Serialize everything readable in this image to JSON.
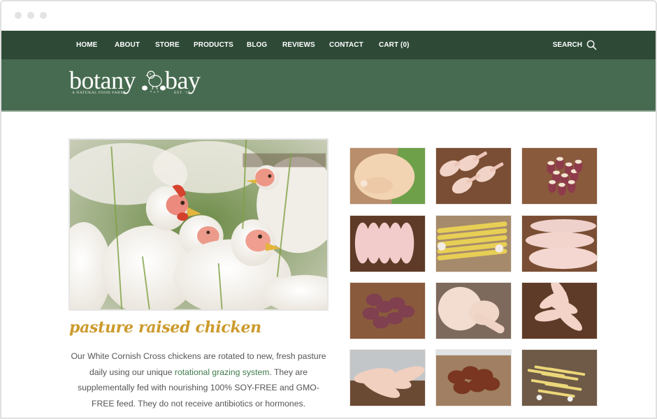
{
  "browser": {
    "window_controls": [
      "close",
      "minimize",
      "maximize"
    ]
  },
  "nav": {
    "items": [
      {
        "label": "HOME"
      },
      {
        "label": "ABOUT"
      },
      {
        "label": "STORE"
      },
      {
        "label": "PRODUCTS"
      },
      {
        "label": "BLOG"
      },
      {
        "label": "REVIEWS"
      },
      {
        "label": "CONTACT"
      },
      {
        "label": "CART (0)"
      }
    ],
    "search_label": "SEARCH",
    "search_icon": "search-icon"
  },
  "brand": {
    "word_left": "botany",
    "word_right": "bay",
    "tagline": "A NATURAL FOOD FARM",
    "established": "EST. '11",
    "mascot_icon": "chick-icon"
  },
  "colors": {
    "nav_bg": "#2e4a37",
    "brand_bg": "#476b50",
    "title_gold": "#cc9a2c",
    "link_green": "#3f7a4a",
    "body_text": "#555555"
  },
  "main": {
    "hero_alt": "White Cornish Cross chickens on pasture",
    "title": "pasture raised chicken",
    "description": {
      "before_link": "Our White Cornish Cross chickens are rotated to new, fresh pasture daily using our unique ",
      "link_text": "rotational grazing system",
      "after_link": ". They are supplementally fed with nourishing 100% SOY-FREE and GMO-FREE feed. They do not receive antibiotics or hormones."
    }
  },
  "products": [
    {
      "name": "whole chicken",
      "kind": "whole"
    },
    {
      "name": "chicken leg quarters",
      "kind": "legs"
    },
    {
      "name": "chicken hearts",
      "kind": "hearts"
    },
    {
      "name": "boneless breasts",
      "kind": "breasts"
    },
    {
      "name": "chicken feet",
      "kind": "feet"
    },
    {
      "name": "breast fillets",
      "kind": "fillets"
    },
    {
      "name": "chicken livers",
      "kind": "livers"
    },
    {
      "name": "chicken thighs and drumsticks",
      "kind": "quarters"
    },
    {
      "name": "chicken wings",
      "kind": "wings"
    },
    {
      "name": "wing sections",
      "kind": "wings2"
    },
    {
      "name": "chicken gizzards",
      "kind": "gizzards"
    },
    {
      "name": "chicken feet prepared",
      "kind": "feet2"
    }
  ]
}
